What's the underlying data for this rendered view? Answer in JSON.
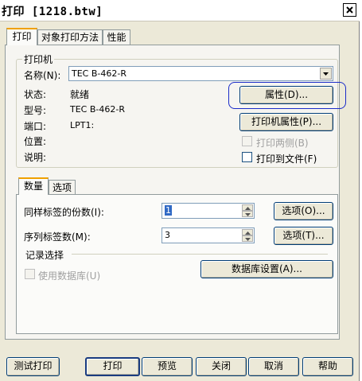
{
  "window": {
    "title": "打印 [1218.btw]"
  },
  "main_tabs": [
    {
      "label": "打印"
    },
    {
      "label": "对象打印方法"
    },
    {
      "label": "性能"
    }
  ],
  "printer_group": {
    "title": "打印机",
    "name_label": "名称(N):",
    "name_value": "TEC B-462-R",
    "status_label": "状态:",
    "status_value": "就绪",
    "model_label": "型号:",
    "model_value": "TEC B-462-R",
    "port_label": "端口:",
    "port_value": "LPT1:",
    "location_label": "位置:",
    "comment_label": "说明:",
    "properties_button": "属性(D)...",
    "printer_properties_button": "打印机属性(P)...",
    "duplex_label": "打印两侧(B)",
    "print_to_file_label": "打印到文件(F)"
  },
  "sub_tabs": [
    {
      "label": "数量"
    },
    {
      "label": "选项"
    }
  ],
  "quantity": {
    "copies_label": "同样标签的份数(I):",
    "copies_value": "1",
    "copies_options_button": "选项(O)...",
    "serial_label": "序列标签数(M):",
    "serial_value": "3",
    "serial_options_button": "选项(T)..."
  },
  "records": {
    "title": "记录选择",
    "use_database_label": "使用数据库(U)",
    "database_settings_button": "数据库设置(A)..."
  },
  "bottom_buttons": {
    "test_print": "测试打印",
    "print": "打印",
    "preview": "预览",
    "close": "关闭",
    "cancel": "取消",
    "help": "帮助"
  },
  "icons": {
    "close": "close-icon",
    "dropdown": "chevron-down-icon",
    "spin_up": "arrow-up-icon",
    "spin_down": "arrow-down-icon"
  },
  "colors": {
    "dialog_bg": "#ece9d8",
    "tab_accent": "#f0a000",
    "highlight_ring": "#1b2cc9",
    "selection": "#316ac5"
  }
}
